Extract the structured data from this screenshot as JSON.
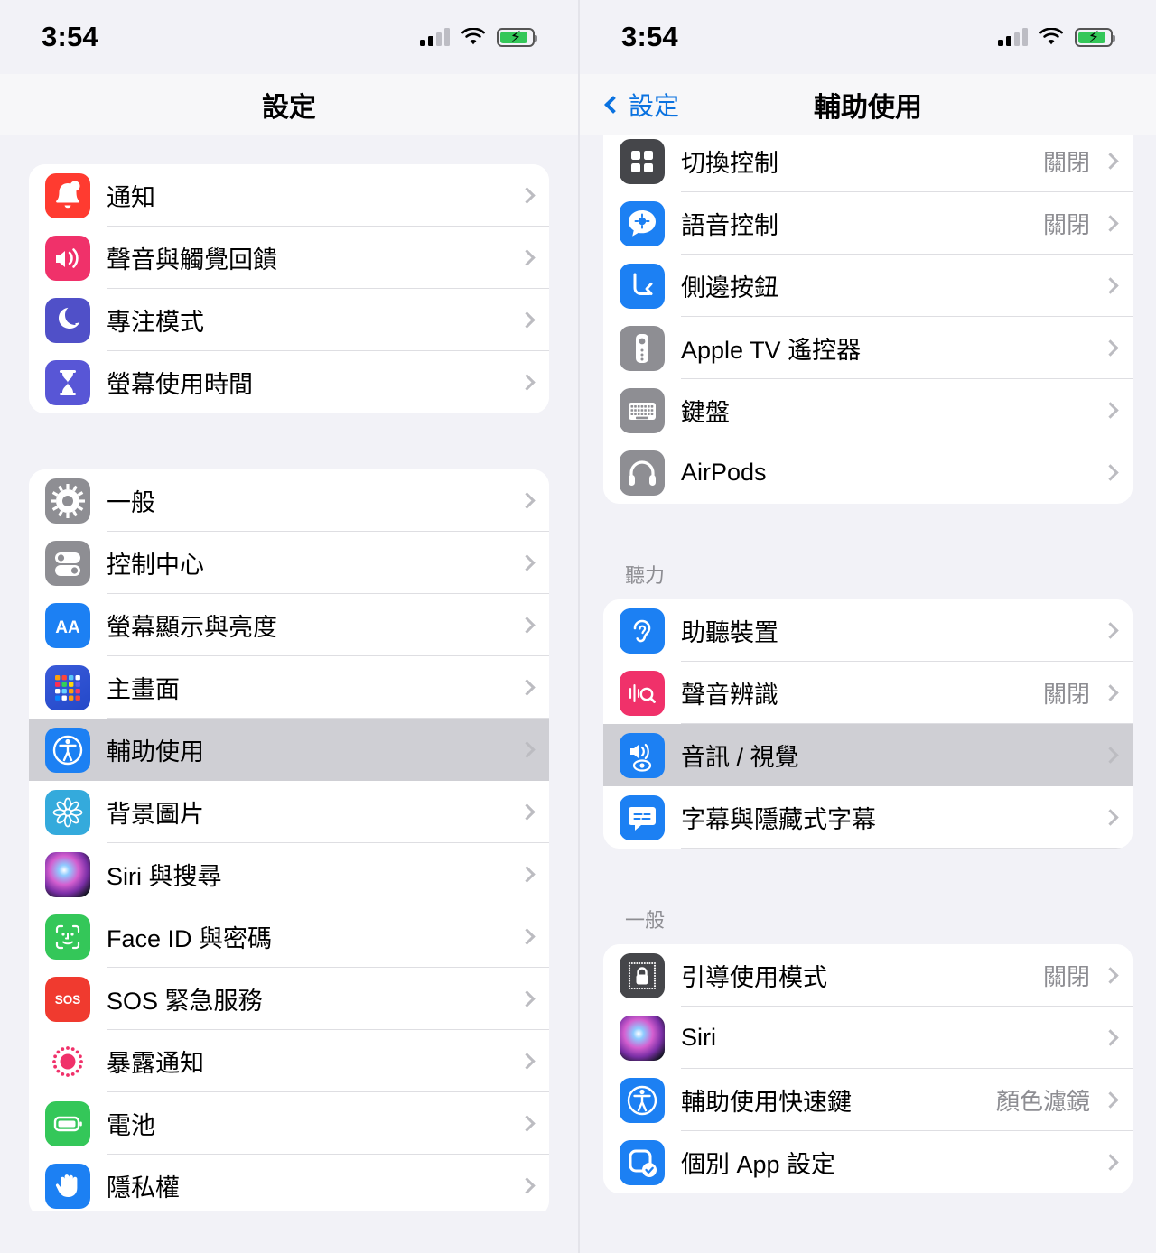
{
  "left": {
    "statusbar": {
      "time": "3:54",
      "battery_state": "charging",
      "wifi": "wifi-icon",
      "signal": "cellular-icon"
    },
    "nav": {
      "title": "設定"
    },
    "groups": [
      {
        "header": "",
        "items": [
          {
            "label": "通知",
            "value": "",
            "icon": "bell-icon",
            "selected": false
          },
          {
            "label": "聲音與觸覺回饋",
            "value": "",
            "icon": "speaker-waves-icon",
            "selected": false
          },
          {
            "label": "專注模式",
            "value": "",
            "icon": "moon-icon",
            "selected": false
          },
          {
            "label": "螢幕使用時間",
            "value": "",
            "icon": "hourglass-icon",
            "selected": false
          }
        ]
      },
      {
        "header": "",
        "items": [
          {
            "label": "一般",
            "value": "",
            "icon": "gear-icon",
            "selected": false
          },
          {
            "label": "控制中心",
            "value": "",
            "icon": "toggles-icon",
            "selected": false
          },
          {
            "label": "螢幕顯示與亮度",
            "value": "",
            "icon": "aa-text-icon",
            "selected": false
          },
          {
            "label": "主畫面",
            "value": "",
            "icon": "home-screen-grid-icon",
            "selected": false
          },
          {
            "label": "輔助使用",
            "value": "",
            "icon": "accessibility-icon",
            "selected": true
          },
          {
            "label": "背景圖片",
            "value": "",
            "icon": "wallpaper-flower-icon",
            "selected": false
          },
          {
            "label": "Siri 與搜尋",
            "value": "",
            "icon": "siri-orb-icon",
            "selected": false
          },
          {
            "label": "Face ID 與密碼",
            "value": "",
            "icon": "face-id-icon",
            "selected": false
          },
          {
            "label": "SOS 緊急服務",
            "value": "",
            "icon": "sos-icon",
            "selected": false
          },
          {
            "label": "暴露通知",
            "value": "",
            "icon": "exposure-notification-icon",
            "selected": false
          },
          {
            "label": "電池",
            "value": "",
            "icon": "battery-icon",
            "selected": false
          },
          {
            "label": "隱私權",
            "value": "",
            "icon": "privacy-hand-icon",
            "selected": false
          }
        ]
      }
    ]
  },
  "right": {
    "statusbar": {
      "time": "3:54",
      "battery_state": "charging",
      "wifi": "wifi-icon",
      "signal": "cellular-icon"
    },
    "nav": {
      "back_label": "設定",
      "title": "輔助使用"
    },
    "groups": [
      {
        "header": "",
        "items": [
          {
            "label": "切換控制",
            "value": "關閉",
            "icon": "switch-control-icon",
            "selected": false
          },
          {
            "label": "語音控制",
            "value": "關閉",
            "icon": "voice-control-icon",
            "selected": false
          },
          {
            "label": "側邊按鈕",
            "value": "",
            "icon": "side-button-icon",
            "selected": false
          },
          {
            "label": "Apple TV 遙控器",
            "value": "",
            "icon": "apple-tv-remote-icon",
            "selected": false
          },
          {
            "label": "鍵盤",
            "value": "",
            "icon": "keyboard-icon",
            "selected": false
          },
          {
            "label": "AirPods",
            "value": "",
            "icon": "airpods-headphones-icon",
            "selected": false
          }
        ]
      },
      {
        "header": "聽力",
        "items": [
          {
            "label": "助聽裝置",
            "value": "",
            "icon": "hearing-ear-icon",
            "selected": false
          },
          {
            "label": "聲音辨識",
            "value": "關閉",
            "icon": "sound-recognition-icon",
            "selected": false
          },
          {
            "label": "音訊 / 視覺",
            "value": "",
            "icon": "audio-visual-icon",
            "selected": true
          },
          {
            "label": "字幕與隱藏式字幕",
            "value": "",
            "icon": "subtitles-icon",
            "selected": false
          }
        ]
      },
      {
        "header": "一般",
        "items": [
          {
            "label": "引導使用模式",
            "value": "關閉",
            "icon": "guided-access-lock-icon",
            "selected": false
          },
          {
            "label": "Siri",
            "value": "",
            "icon": "siri-orb-icon",
            "selected": false
          },
          {
            "label": "輔助使用快速鍵",
            "value": "顏色濾鏡",
            "icon": "accessibility-icon",
            "selected": false
          },
          {
            "label": "個別 App 設定",
            "value": "",
            "icon": "per-app-settings-icon",
            "selected": false
          }
        ]
      }
    ]
  },
  "colors": {
    "accent_blue": "#0a72e0",
    "selected_row": "#cfcfd4",
    "page_bg": "#f2f2f7",
    "card_bg": "#ffffff",
    "secondary_text": "#8d8d92",
    "battery_green": "#34c759"
  }
}
